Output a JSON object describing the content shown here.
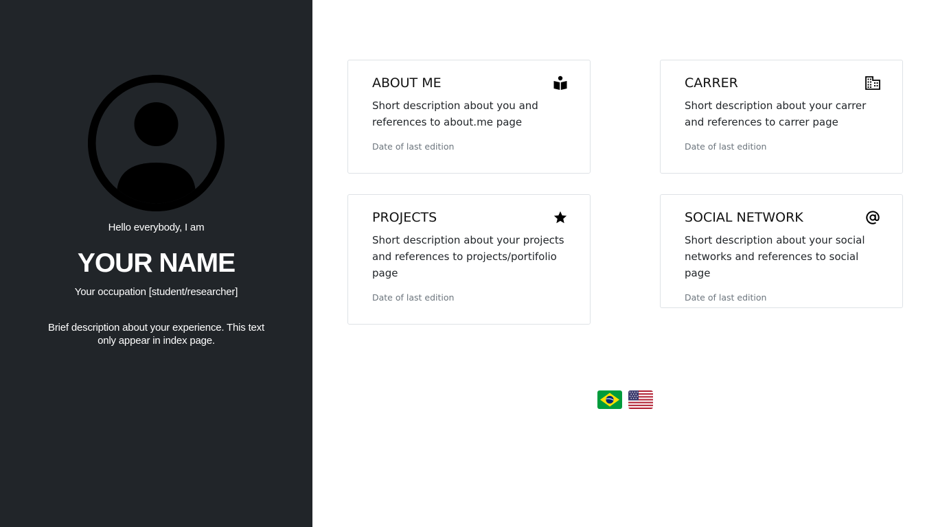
{
  "profile": {
    "greeting": "Hello everybody, I am",
    "name": "YOUR NAME",
    "occupation": "Your occupation [student/researcher]",
    "bio": "Brief description about your experience. This text only appear in index page.",
    "avatar_icon": "account-circle-icon"
  },
  "cards": [
    {
      "title": "ABOUT ME",
      "icon": "book-reader-icon",
      "text": "Short description about you and references to about.me page",
      "date": "Date of last edition"
    },
    {
      "title": "CARRER",
      "icon": "building-icon",
      "text": "Short description about your carrer and references to carrer page",
      "date": "Date of last edition"
    },
    {
      "title": "PROJECTS",
      "icon": "star-icon",
      "text": "Short description about your projects and references to projects/portifolio page",
      "date": "Date of last edition"
    },
    {
      "title": "SOCIAL NETWORK",
      "icon": "at-sign-icon",
      "text": "Short description about your social networks and references to social page",
      "date": "Date of last edition"
    }
  ],
  "languages": [
    {
      "icon": "brazil-flag-icon"
    },
    {
      "icon": "usa-flag-icon"
    }
  ],
  "colors": {
    "sidebar_bg": "#212529",
    "card_border": "#dee2e6",
    "muted_text": "#6c757d"
  }
}
